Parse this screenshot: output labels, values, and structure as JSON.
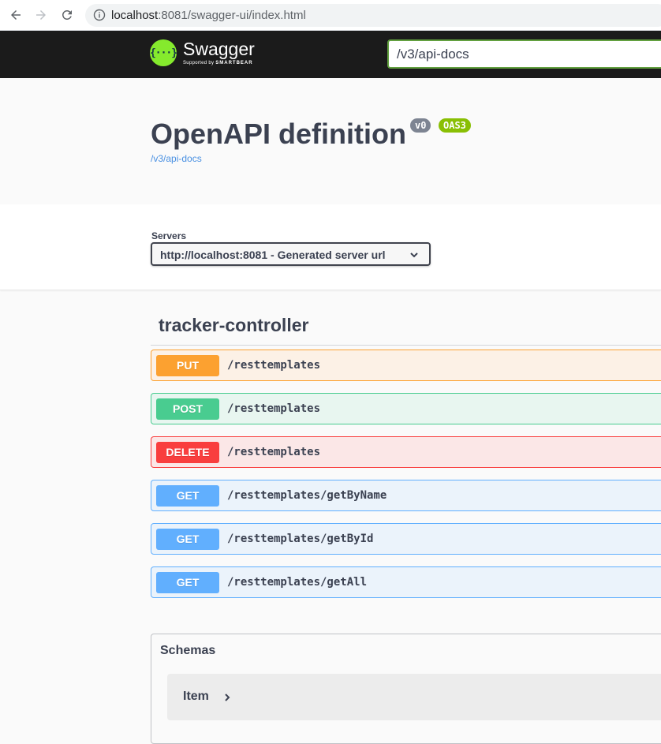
{
  "browser": {
    "url_host": "localhost",
    "url_rest": ":8081/swagger-ui/index.html"
  },
  "topbar": {
    "logo_icon": "{···}",
    "logo_name": "Swagger",
    "logo_sub_prefix": "Supported by",
    "logo_sub_brand": "SMARTBEAR",
    "spec_url": "/v3/api-docs"
  },
  "info": {
    "title": "OpenAPI definition",
    "version_badge": "v0",
    "oas_badge": "OAS3",
    "spec_link": "/v3/api-docs"
  },
  "servers": {
    "label": "Servers",
    "selected": "http://localhost:8081 - Generated server url"
  },
  "tag": {
    "name": "tracker-controller"
  },
  "operations": [
    {
      "method": "PUT",
      "path": "/resttemplates"
    },
    {
      "method": "POST",
      "path": "/resttemplates"
    },
    {
      "method": "DELETE",
      "path": "/resttemplates"
    },
    {
      "method": "GET",
      "path": "/resttemplates/getByName"
    },
    {
      "method": "GET",
      "path": "/resttemplates/getById"
    },
    {
      "method": "GET",
      "path": "/resttemplates/getAll"
    }
  ],
  "schemas": {
    "title": "Schemas",
    "items": [
      {
        "name": "Item"
      }
    ]
  },
  "colors": {
    "put": "#fca130",
    "post": "#49cc90",
    "delete": "#f93e3e",
    "get": "#61affe",
    "swagger_green": "#85ea2d",
    "topbar": "#1b1b1b"
  }
}
